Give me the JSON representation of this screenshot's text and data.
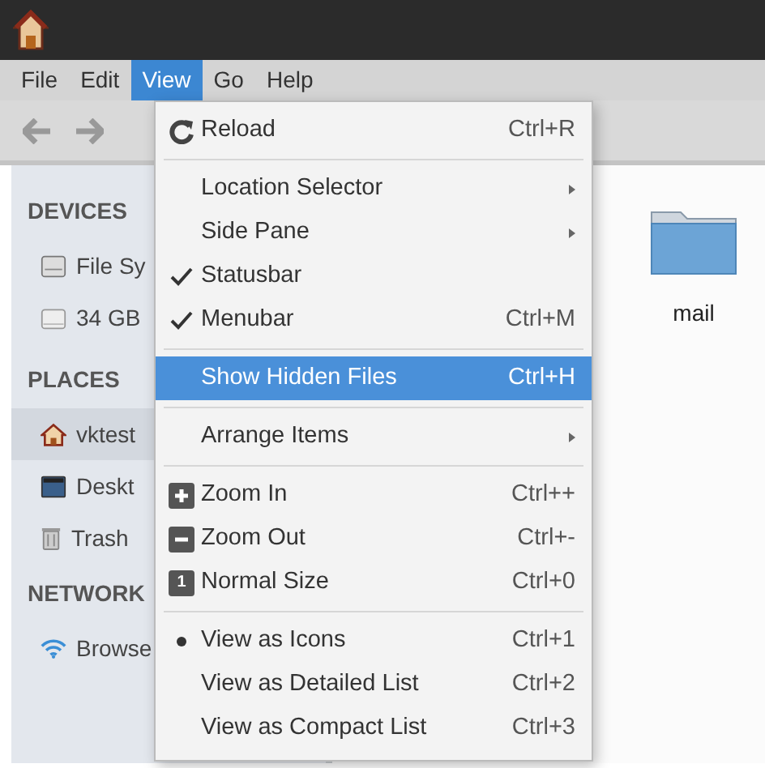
{
  "menubar": [
    {
      "label": "File",
      "selected": false
    },
    {
      "label": "Edit",
      "selected": false
    },
    {
      "label": "View",
      "selected": true
    },
    {
      "label": "Go",
      "selected": false
    },
    {
      "label": "Help",
      "selected": false
    }
  ],
  "sidebar": [
    {
      "heading": "DEVICES",
      "items": [
        {
          "label": "File Sy",
          "kind": "drive",
          "selected": false
        },
        {
          "label": "34 GB",
          "kind": "disk",
          "selected": false
        }
      ]
    },
    {
      "heading": "PLACES",
      "items": [
        {
          "label": "vktest",
          "kind": "home",
          "selected": true
        },
        {
          "label": "Deskt",
          "kind": "desktop",
          "selected": false
        },
        {
          "label": "Trash",
          "kind": "trash",
          "selected": false
        }
      ]
    },
    {
      "heading": "NETWORK",
      "items": [
        {
          "label": "Browse",
          "kind": "network",
          "selected": false
        }
      ]
    }
  ],
  "files": [
    {
      "label": "mail"
    }
  ],
  "view_menu": [
    {
      "kind": "reload",
      "label": "Reload",
      "shortcut": "Ctrl+R",
      "highlighted": false
    },
    {
      "kind": "separator"
    },
    {
      "kind": "submenu",
      "label": "Location Selector",
      "highlighted": false
    },
    {
      "kind": "submenu",
      "label": "Side Pane",
      "highlighted": false
    },
    {
      "kind": "check",
      "label": "Statusbar",
      "checked": true,
      "highlighted": false
    },
    {
      "kind": "check",
      "label": "Menubar",
      "shortcut": "Ctrl+M",
      "checked": true,
      "highlighted": false
    },
    {
      "kind": "separator"
    },
    {
      "kind": "check",
      "label": "Show Hidden Files",
      "shortcut": "Ctrl+H",
      "checked": false,
      "highlighted": true
    },
    {
      "kind": "separator"
    },
    {
      "kind": "submenu",
      "label": "Arrange Items",
      "highlighted": false
    },
    {
      "kind": "separator"
    },
    {
      "kind": "enlarge",
      "label": "Zoom In",
      "shortcut": "Ctrl++",
      "highlighted": false
    },
    {
      "kind": "shrink",
      "label": "Zoom Out",
      "shortcut": "Ctrl+-",
      "highlighted": false
    },
    {
      "kind": "reset",
      "label": "Normal Size",
      "shortcut": "Ctrl+0",
      "icon_text": "1",
      "highlighted": false
    },
    {
      "kind": "separator"
    },
    {
      "kind": "radio",
      "label": "View as Icons",
      "shortcut": "Ctrl+1",
      "selected": true,
      "highlighted": false
    },
    {
      "kind": "radio",
      "label": "View as Detailed List",
      "shortcut": "Ctrl+2",
      "selected": false,
      "highlighted": false
    },
    {
      "kind": "radio",
      "label": "View as Compact List",
      "shortcut": "Ctrl+3",
      "selected": false,
      "highlighted": false
    }
  ]
}
